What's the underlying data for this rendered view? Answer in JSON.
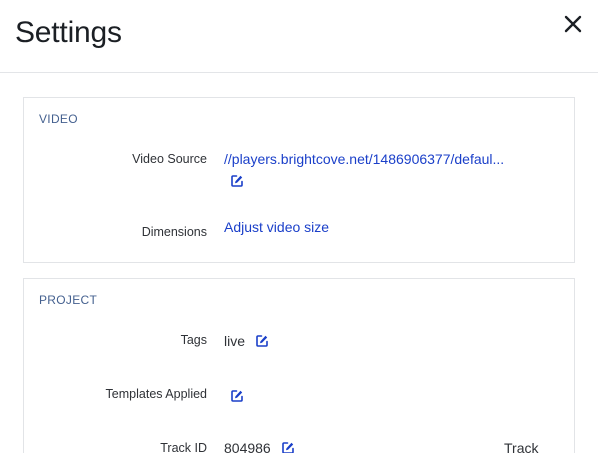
{
  "header": {
    "title": "Settings"
  },
  "video": {
    "heading": "VIDEO",
    "source_label": "Video Source",
    "source_value": "//players.brightcove.net/1486906377/defaul...",
    "dimensions_label": "Dimensions",
    "dimensions_link": "Adjust video size"
  },
  "project": {
    "heading": "PROJECT",
    "tags_label": "Tags",
    "tags_value": "live",
    "templates_label": "Templates Applied",
    "track_label": "Track ID",
    "track_value": "804986",
    "track_right_label": "Track"
  },
  "icons": {
    "close": "close-icon",
    "edit": "edit-icon"
  },
  "colors": {
    "link": "#1a3fc9",
    "section_heading": "#44608f",
    "border": "#e2e4e7"
  }
}
